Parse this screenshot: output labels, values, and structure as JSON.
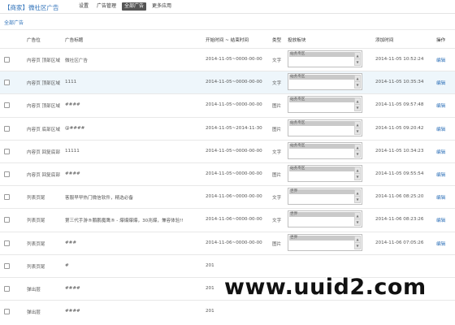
{
  "header": {
    "app_title": "【商家】微社区广告",
    "nav": [
      {
        "label": "设置",
        "active": false
      },
      {
        "label": "广告管理",
        "active": false
      },
      {
        "label": "全部广告",
        "active": true
      },
      {
        "label": "更多应用",
        "active": false
      }
    ]
  },
  "breadcrumb": "全部广告",
  "columns": [
    "广告位",
    "广告标题",
    "开始时间 ~ 结束时间",
    "类型",
    "投放板块",
    "添加时间",
    "操作"
  ],
  "rows": [
    {
      "position": "内容页 顶部区域",
      "title": "微社区广告",
      "time": "2014-11-05~0000-00-00",
      "type": "文字",
      "region": "站务专区",
      "added": "2014-11-05 10:52:24",
      "action": "编辑",
      "highlight": false
    },
    {
      "position": "内容页 顶部区域",
      "title": "1111",
      "time": "2014-11-05~0000-00-00",
      "type": "文字",
      "region": "站务专区",
      "added": "2014-11-05 10:35:34",
      "action": "编辑",
      "highlight": true
    },
    {
      "position": "内容页 顶部区域",
      "title": "####",
      "time": "2014-11-05~0000-00-00",
      "type": "图片",
      "region": "站务专区",
      "added": "2014-11-05 09:57:48",
      "action": "编辑",
      "highlight": false
    },
    {
      "position": "内容页 底部区域",
      "title": "@####",
      "time": "2014-11-05~2014-11-30",
      "type": "图片",
      "region": "站务专区",
      "added": "2014-11-05 09:20:42",
      "action": "编辑",
      "highlight": false
    },
    {
      "position": "内容页 回复底部",
      "title": "11111",
      "time": "2014-11-05~0000-00-00",
      "type": "文字",
      "region": "站务专区",
      "added": "2014-11-05 10:34:23",
      "action": "编辑",
      "highlight": false
    },
    {
      "position": "内容页 回复底部",
      "title": "####",
      "time": "2014-11-05~0000-00-00",
      "type": "图片",
      "region": "站务专区",
      "added": "2014-11-05 09:55:54",
      "action": "编辑",
      "highlight": false
    },
    {
      "position": "列表页尾",
      "title": "客服早早热门微信软件，精选必备",
      "time": "2014-11-06~0000-00-00",
      "type": "文字",
      "region": "世界",
      "added": "2014-11-06 08:25:20",
      "action": "编辑",
      "highlight": false
    },
    {
      "position": "列表页尾",
      "title": "第三代手游®鹏鹏魔鹰® - 爆爆爆爆，30兆爆，兼容体验!!",
      "time": "2014-11-06~0000-00-00",
      "type": "文字",
      "region": "世界",
      "added": "2014-11-06 08:23:26",
      "action": "编辑",
      "highlight": false
    },
    {
      "position": "列表页尾",
      "title": "###",
      "time": "2014-11-06~0000-00-00",
      "type": "图片",
      "region": "世界",
      "added": "2014-11-06 07:05:26",
      "action": "编辑",
      "highlight": false
    },
    {
      "position": "列表页尾",
      "title": "#",
      "time": "201",
      "type": "",
      "region": "",
      "added": "",
      "action": "",
      "highlight": false
    },
    {
      "position": "弹出层",
      "title": "####",
      "time": "201",
      "type": "",
      "region": "",
      "added": "",
      "action": "",
      "highlight": false
    },
    {
      "position": "弹出层",
      "title": "####",
      "time": "201",
      "type": "",
      "region": "",
      "added": "",
      "action": "",
      "highlight": false
    }
  ],
  "watermark": "www.uuid2.com"
}
